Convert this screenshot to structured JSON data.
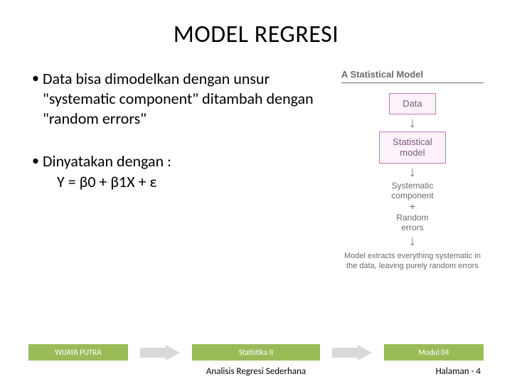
{
  "title": "MODEL REGRESI",
  "bullets": [
    "Data bisa dimodelkan dengan unsur \"systematic component\" ditambah dengan \"random errors\"",
    "Dinyatakan dengan :"
  ],
  "equation": "Y = β0 + β1X + ε",
  "diagram": {
    "heading": "A Statistical Model",
    "box1": "Data",
    "box2": "Statistical\nmodel",
    "line1": "Systematic",
    "line2": "component",
    "plus": "+",
    "line3": "Random",
    "line4": "errors",
    "caption": "Model extracts everything systematic in the data, leaving purely random errors"
  },
  "footer": {
    "tag1": "WIJAYA PUTRA",
    "tag2": "Statistika II",
    "tag3": "Modul 04",
    "subtitle": "Analisis Regresi Sederhana",
    "page": "Halaman - 4"
  }
}
